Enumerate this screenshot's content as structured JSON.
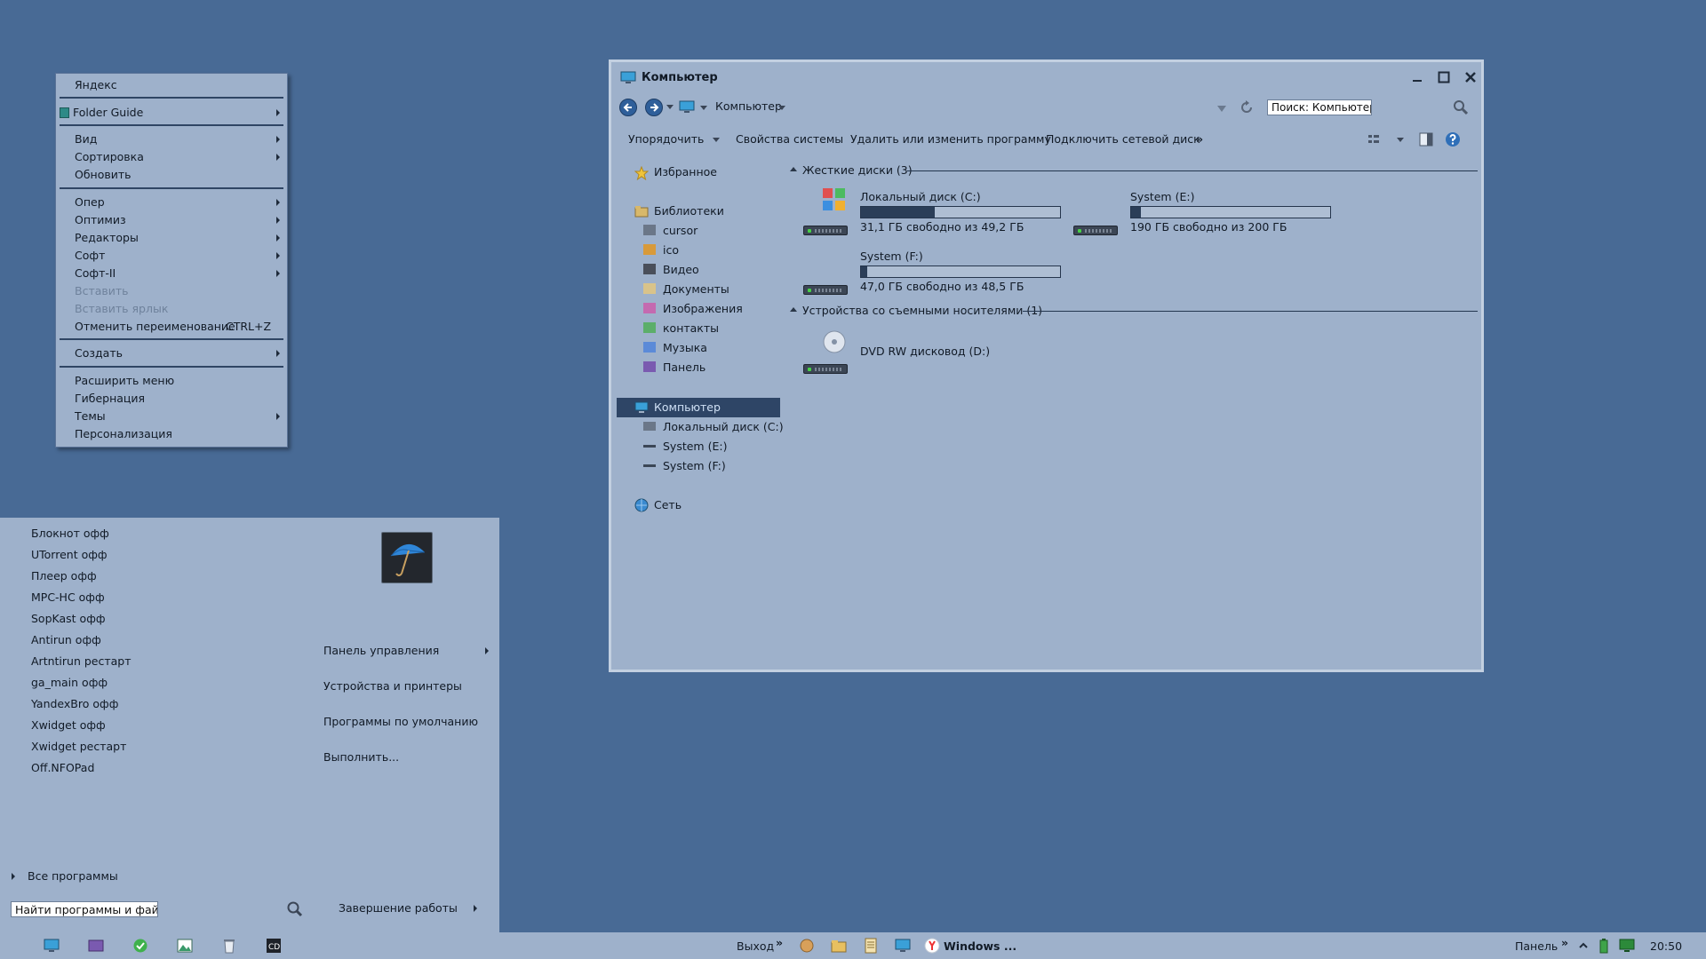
{
  "context_menu": {
    "items": [
      {
        "label": "Яндекс"
      },
      {
        "label": "Folder Guide"
      },
      {
        "label": "Вид"
      },
      {
        "label": "Сортировка"
      },
      {
        "label": "Обновить"
      },
      {
        "label": "Опер"
      },
      {
        "label": "Оптимиз"
      },
      {
        "label": "Редакторы"
      },
      {
        "label": "Софт"
      },
      {
        "label": "Софт-II"
      },
      {
        "label": "Вставить"
      },
      {
        "label": "Вставить ярлык"
      },
      {
        "label": "Отменить переименование",
        "shortcut": "CTRL+Z"
      },
      {
        "label": "Создать"
      },
      {
        "label": "Расширить меню"
      },
      {
        "label": "Гибернация"
      },
      {
        "label": "Темы"
      },
      {
        "label": "Персонализация"
      }
    ]
  },
  "start_menu": {
    "programs": [
      "Блокнот офф",
      "UTorrent офф",
      "Плеер офф",
      "MPC-HC офф",
      "SopKast офф",
      "Antirun офф",
      "Artntirun рестарт",
      "ga_main офф",
      "YandexBro офф",
      "Xwidget офф",
      "Xwidget рестарт",
      "Off.NFOPad"
    ],
    "right_links": [
      "Панель управления",
      "Устройства и принтеры",
      "Программы по умолчанию",
      "Выполнить..."
    ],
    "all_programs": "Все программы",
    "search_placeholder": "Найти программы и файлы",
    "shutdown": "Завершение работы"
  },
  "explorer": {
    "title": "Компьютер",
    "address": "Компьютер",
    "search_placeholder": "Поиск: Компьютер",
    "toolbar": {
      "organize": "Упорядочить",
      "system_properties": "Свойства системы",
      "uninstall": "Удалить или изменить программу",
      "map_drive": "Подключить сетевой диск",
      "more": "»"
    },
    "nav": {
      "favorites": "Избранное",
      "libraries": "Библиотеки",
      "library_items": [
        "cursor",
        "ico",
        "Видео",
        "Документы",
        "Изображения",
        "контакты",
        "Музыка",
        "Панель"
      ],
      "computer": "Компьютер",
      "computer_items": [
        "Локальный диск (C:)",
        "System (E:)",
        "System (F:)"
      ],
      "network": "Сеть"
    },
    "groups": {
      "hard_disks": "Жесткие диски (3)",
      "removable": "Устройства со съемными носителями (1)"
    },
    "drives": [
      {
        "name": "Локальный диск (C:)",
        "free": "31,1 ГБ свободно из 49,2 ГБ",
        "used_fraction": 0.37
      },
      {
        "name": "System (E:)",
        "free": "190 ГБ свободно из 200 ГБ",
        "used_fraction": 0.05
      },
      {
        "name": "System (F:)",
        "free": "47,0 ГБ свободно из 48,5 ГБ",
        "used_fraction": 0.03
      }
    ],
    "dvd": "DVD RW дисковод (D:)"
  },
  "taskbar": {
    "exit": "Выход",
    "window_button": "Windows ...",
    "panel": "Панель",
    "time": "20:50"
  },
  "colors": {
    "desktop": "#486a95",
    "panel": "#9eb1cb",
    "selection": "#2e4566"
  }
}
